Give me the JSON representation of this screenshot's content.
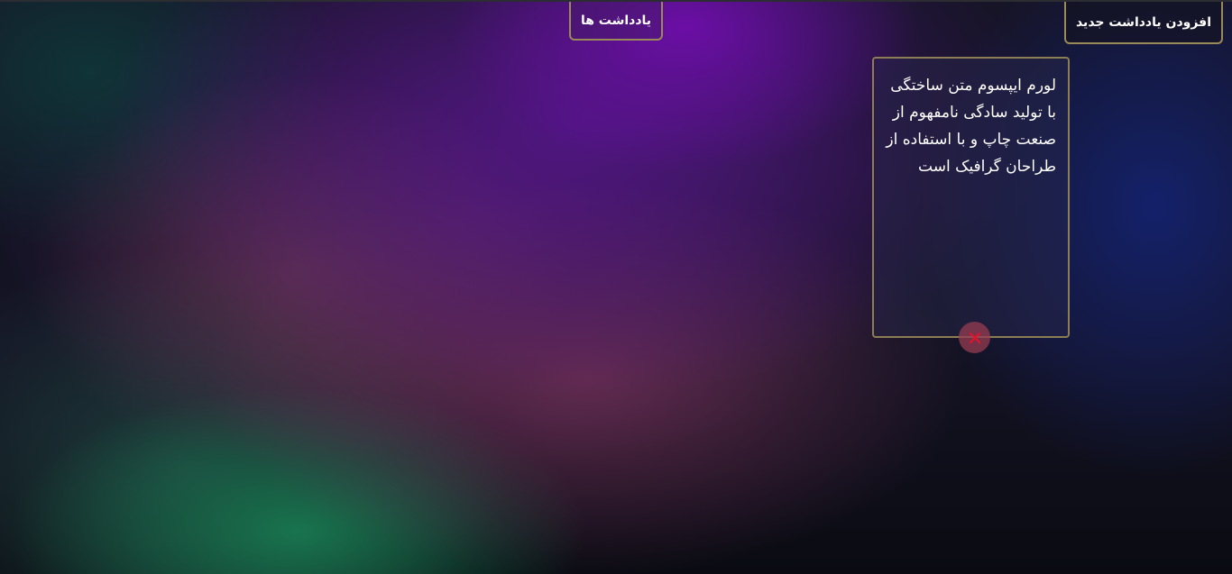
{
  "header": {
    "add_note_label": "افزودن یادداشت جدید",
    "notes_label": "یادداشت ها"
  },
  "notes": [
    {
      "text": "لورم ایپسوم متن ساختگی با تولید سادگی نامفهوم از صنعت چاپ و با استفاده از طراحان گرافیک است",
      "delete_icon": "close-icon"
    }
  ],
  "colors": {
    "button_border": "#9a8a58",
    "card_border": "#8c7d55",
    "delete_icon": "#e0142e",
    "delete_bg": "#963c50"
  }
}
